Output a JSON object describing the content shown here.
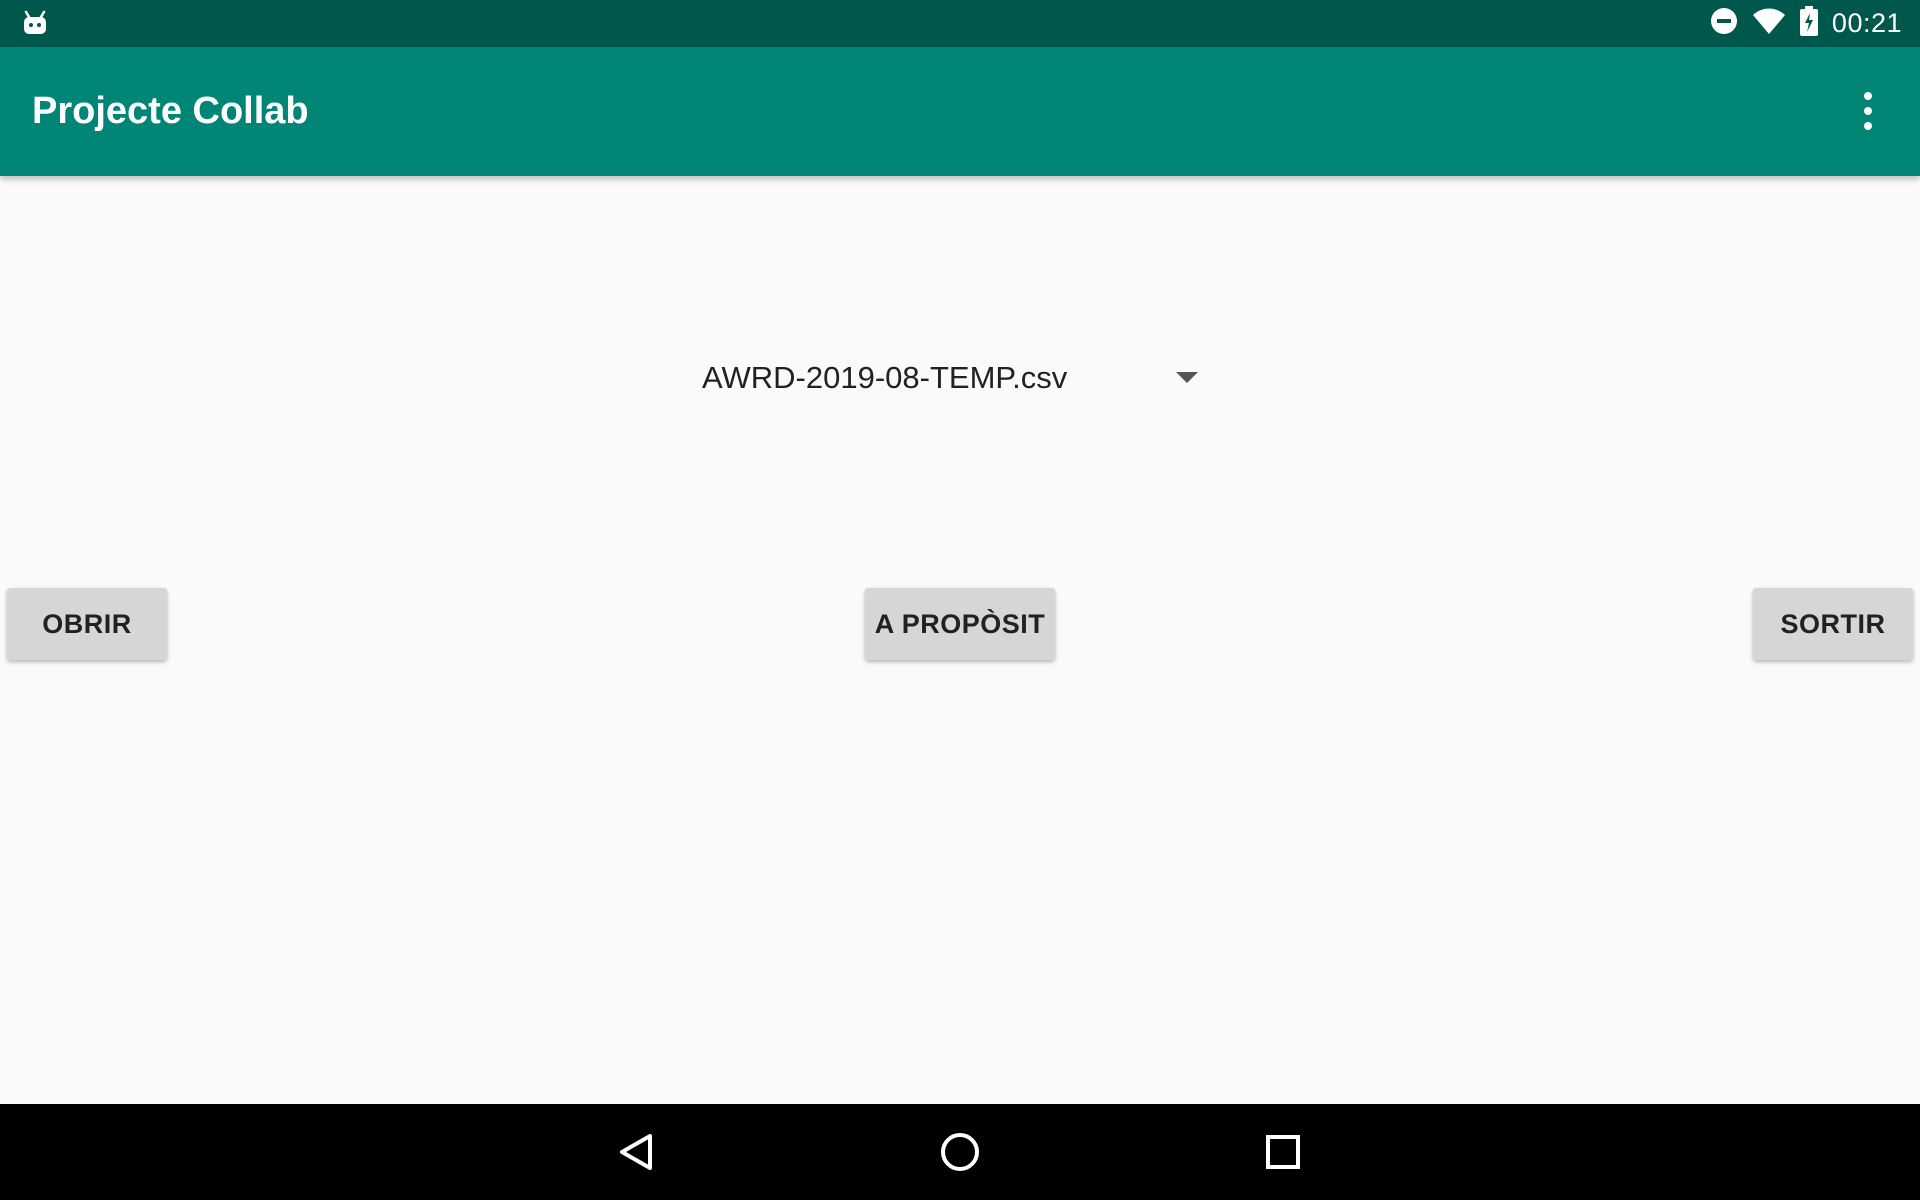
{
  "status_bar": {
    "time": "00:21",
    "icons": [
      "android-icon",
      "do-not-disturb-icon",
      "wifi-icon",
      "battery-charging-icon"
    ]
  },
  "app_bar": {
    "title": "Projecte Collab",
    "menu_icon": "more-vert-icon"
  },
  "spinner": {
    "selected": "AWRD-2019-08-TEMP.csv",
    "arrow_icon": "dropdown-arrow-icon"
  },
  "buttons": {
    "open": "OBRIR",
    "about": "A PROPÒSIT",
    "exit": "SORTIR"
  },
  "nav_bar": {
    "icons": [
      "back-icon",
      "home-icon",
      "recents-icon"
    ]
  },
  "colors": {
    "status_bar": "#00574b",
    "app_bar": "#008577",
    "background": "#fafafa",
    "button": "#d6d6d6",
    "nav_bar": "#000000"
  }
}
